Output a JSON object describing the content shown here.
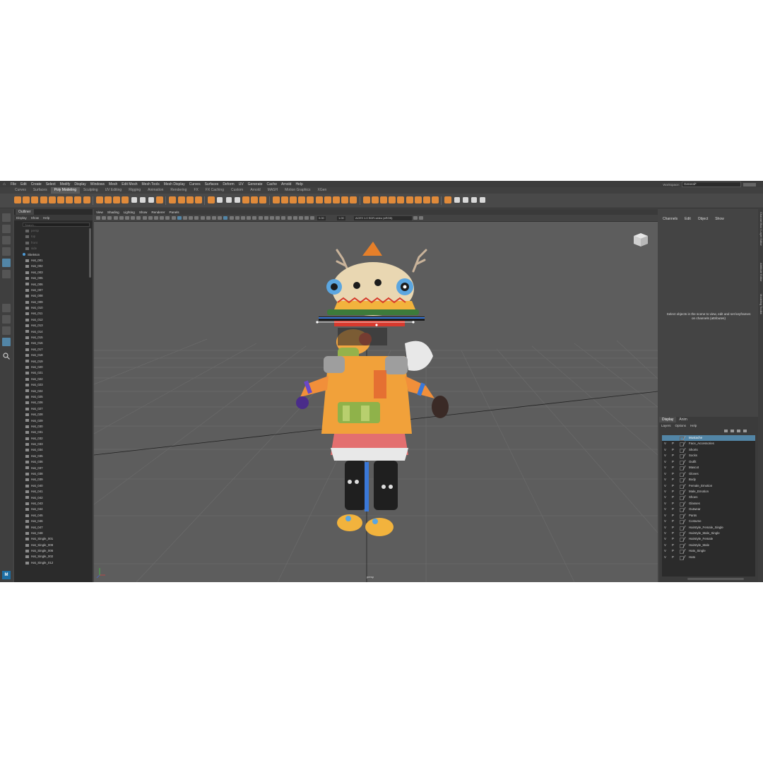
{
  "menubar": {
    "items": [
      "File",
      "Edit",
      "Create",
      "Select",
      "Modify",
      "Display",
      "Windows",
      "Mesh",
      "Edit Mesh",
      "Mesh Tools",
      "Mesh Display",
      "Curves",
      "Surfaces",
      "Deform",
      "UV",
      "Generate",
      "Cache",
      "Arnold",
      "Help"
    ],
    "workspace_label": "Workspace:",
    "workspace_value": "General*"
  },
  "shelf": {
    "tabs": [
      "Curves",
      "Surfaces",
      "Poly Modeling",
      "Sculpting",
      "UV Editing",
      "Rigging",
      "Animation",
      "Rendering",
      "FX",
      "FX Caching",
      "Custom",
      "Arnold",
      "MASH",
      "Motion Graphics",
      "XGen"
    ],
    "active_tab": "Poly Modeling",
    "accent": "#e08a3a"
  },
  "outliner": {
    "title": "Outliner",
    "menu": [
      "Display",
      "Show",
      "Help"
    ],
    "search_placeholder": "Search...",
    "items": [
      {
        "name": "persp",
        "dim": true
      },
      {
        "name": "top",
        "dim": true
      },
      {
        "name": "front",
        "dim": true
      },
      {
        "name": "side",
        "dim": true
      },
      {
        "name": "Skeleton",
        "skeleton": true
      },
      {
        "name": "Hat_001"
      },
      {
        "name": "Hat_002"
      },
      {
        "name": "Hat_003"
      },
      {
        "name": "Hat_005"
      },
      {
        "name": "Hat_006"
      },
      {
        "name": "Hat_007"
      },
      {
        "name": "Hat_008"
      },
      {
        "name": "Hat_009"
      },
      {
        "name": "Hat_010"
      },
      {
        "name": "Hat_011"
      },
      {
        "name": "Hat_012"
      },
      {
        "name": "Hat_013"
      },
      {
        "name": "Hat_014"
      },
      {
        "name": "Hat_015"
      },
      {
        "name": "Hat_016"
      },
      {
        "name": "Hat_017"
      },
      {
        "name": "Hat_018"
      },
      {
        "name": "Hat_019"
      },
      {
        "name": "Hat_020"
      },
      {
        "name": "Hat_021"
      },
      {
        "name": "Hat_022"
      },
      {
        "name": "Hat_023"
      },
      {
        "name": "Hat_024"
      },
      {
        "name": "Hat_025"
      },
      {
        "name": "Hat_026"
      },
      {
        "name": "Hat_027"
      },
      {
        "name": "Hat_028"
      },
      {
        "name": "Hat_029"
      },
      {
        "name": "Hat_030"
      },
      {
        "name": "Hat_031"
      },
      {
        "name": "Hat_032"
      },
      {
        "name": "Hat_033"
      },
      {
        "name": "Hat_034"
      },
      {
        "name": "Hat_035"
      },
      {
        "name": "Hat_036"
      },
      {
        "name": "Hat_037"
      },
      {
        "name": "Hat_038"
      },
      {
        "name": "Hat_039"
      },
      {
        "name": "Hat_040"
      },
      {
        "name": "Hat_041"
      },
      {
        "name": "Hat_042"
      },
      {
        "name": "Hat_043"
      },
      {
        "name": "Hat_044"
      },
      {
        "name": "Hat_045"
      },
      {
        "name": "Hat_046"
      },
      {
        "name": "Hat_047"
      },
      {
        "name": "Hat_048"
      },
      {
        "name": "Hat_Single_001"
      },
      {
        "name": "Hat_Single_009"
      },
      {
        "name": "Hat_Single_006"
      },
      {
        "name": "Hat_Single_002"
      },
      {
        "name": "Hat_Single_012"
      }
    ]
  },
  "viewport": {
    "menu": [
      "View",
      "Shading",
      "Lighting",
      "Show",
      "Renderer",
      "Panels"
    ],
    "exposure": "0.00",
    "gamma": "1.00",
    "color_space": "ACES 1.0 SDR-video (sRGB)",
    "camera_label": "persp",
    "background": "#5d5d5d"
  },
  "channels": {
    "menu": [
      "Channels",
      "Edit",
      "Object",
      "Show"
    ],
    "empty_message": "Select objects in the scene to view, edit and set keyframes on channels (attributes)"
  },
  "side_tabs": [
    "Channel Box / Layer Editor",
    "Attribute Editor",
    "Modeling Toolkit"
  ],
  "layers": {
    "tabs": [
      "Display",
      "Anim"
    ],
    "menu": [
      "Layers",
      "Options",
      "Help"
    ],
    "items": [
      {
        "name": "Mustache",
        "v": "",
        "p": "",
        "selected": true
      },
      {
        "name": "Face_Accessories",
        "v": "V",
        "p": "P"
      },
      {
        "name": "Shorts",
        "v": "V",
        "p": "P"
      },
      {
        "name": "Socks",
        "v": "V",
        "p": "P"
      },
      {
        "name": "Outfit",
        "v": "V",
        "p": "P"
      },
      {
        "name": "Mascot",
        "v": "V",
        "p": "P"
      },
      {
        "name": "Gloves",
        "v": "V",
        "p": "P"
      },
      {
        "name": "Body",
        "v": "V",
        "p": "P"
      },
      {
        "name": "Female_Emotion",
        "v": "V",
        "p": "P"
      },
      {
        "name": "Male_Emotion",
        "v": "V",
        "p": "P"
      },
      {
        "name": "Shoes",
        "v": "V",
        "p": "P"
      },
      {
        "name": "Glasses",
        "v": "V",
        "p": "P"
      },
      {
        "name": "Outwear",
        "v": "V",
        "p": "P"
      },
      {
        "name": "Pants",
        "v": "V",
        "p": "P"
      },
      {
        "name": "Costume",
        "v": "V",
        "p": "P"
      },
      {
        "name": "Hairstyle_Female_Single",
        "v": "V",
        "p": "P"
      },
      {
        "name": "Hairstyle_Male_Single",
        "v": "V",
        "p": "P"
      },
      {
        "name": "Hairstyle_Female",
        "v": "V",
        "p": "P"
      },
      {
        "name": "Hairstyle_Male",
        "v": "V",
        "p": "P"
      },
      {
        "name": "Hats_Single",
        "v": "V",
        "p": "P"
      },
      {
        "name": "Hats",
        "v": "V",
        "p": "P"
      }
    ]
  }
}
